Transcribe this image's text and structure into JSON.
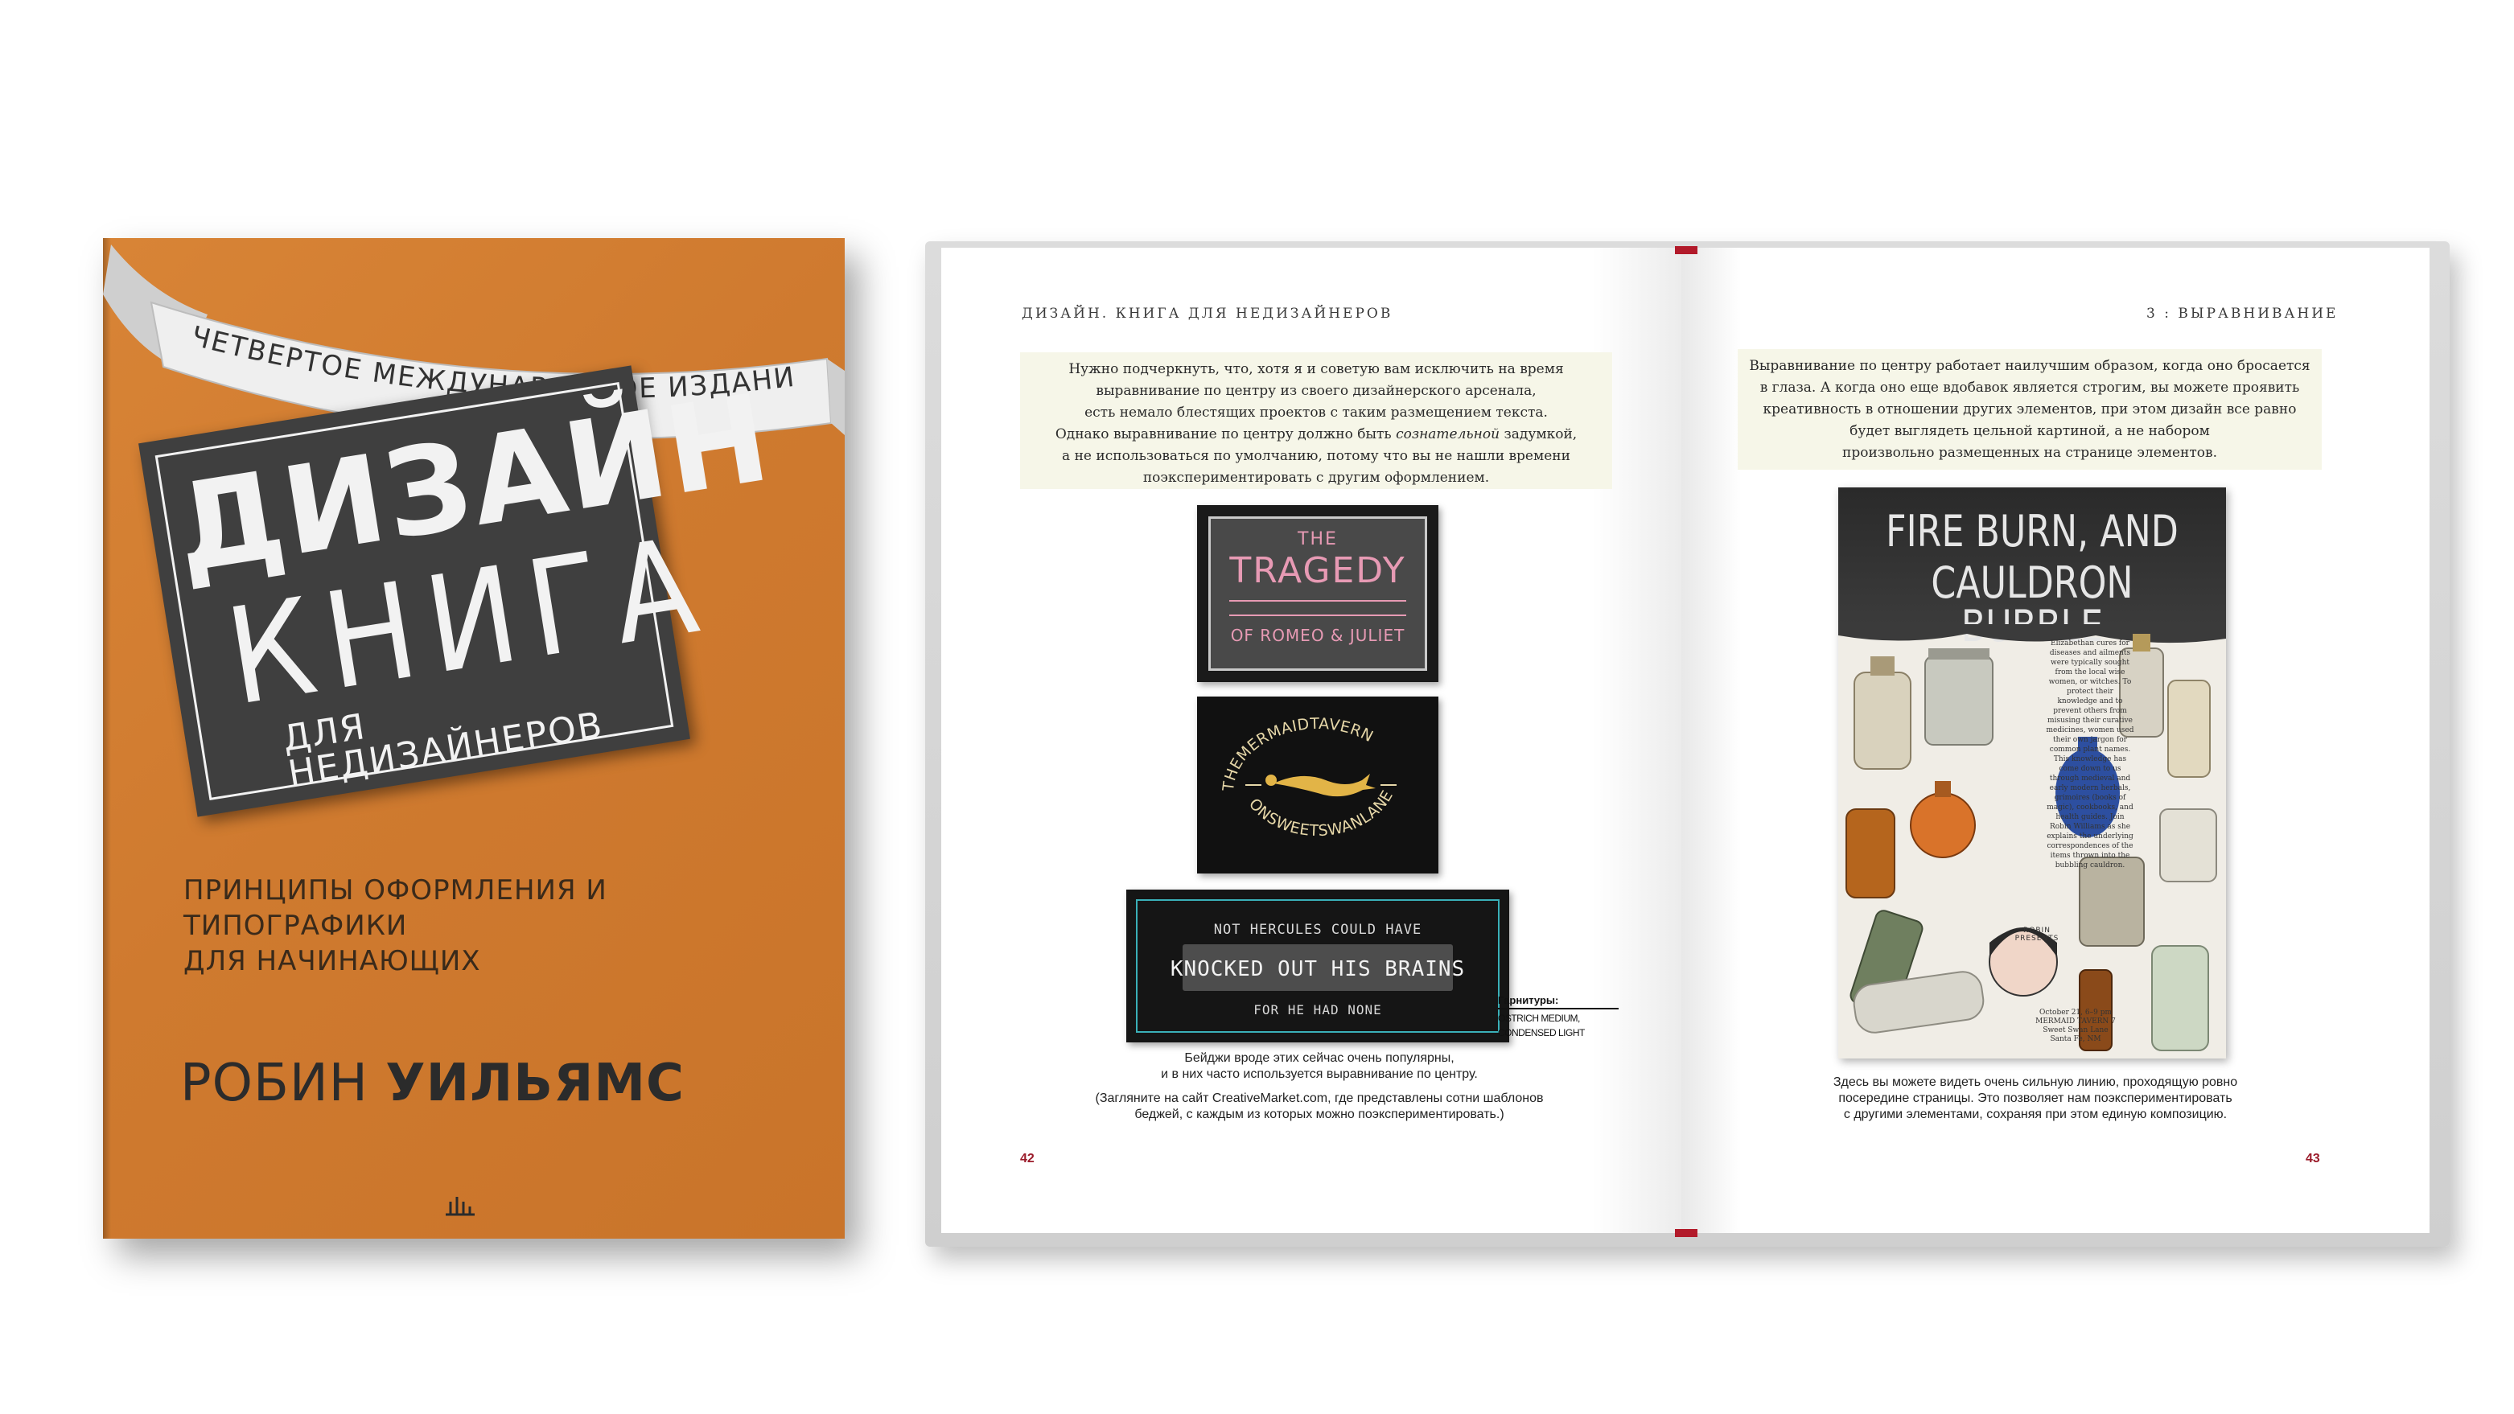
{
  "cover": {
    "edition": "ЧЕТВЕРТОЕ МЕЖДУНАРОДНОЕ ИЗДАНИЕ",
    "title_main": "ДИЗАЙН",
    "title_second": "КНИГА",
    "title_third": "ДЛЯ НЕДИЗАЙНЕРОВ",
    "subtitle_line1": "ПРИНЦИПЫ ОФОРМЛЕНИЯ И ТИПОГРАФИКИ",
    "subtitle_line2": "ДЛЯ НАЧИНАЮЩИХ",
    "author_first": "РОБИН",
    "author_last": "УИЛЬЯМС",
    "colors": {
      "cover": "#d17c30",
      "plate": "#3f3f3f",
      "ribbon": "#efefef"
    }
  },
  "left_page": {
    "running_head": "ДИЗАЙН. КНИГА ДЛЯ НЕДИЗАЙНЕРОВ",
    "note_lines": [
      "Нужно подчеркнуть, что, хотя я и советую вам исключить на время",
      "выравнивание по центру из своего дизайнерского арсенала,",
      "есть немало блестящих проектов с таким размещением текста.",
      "Однако выравнивание по центру должно быть ",
      "сознательной",
      " задумкой,",
      "а не использоваться по умолчанию, потому что вы не нашли времени",
      "поэкспериментировать с другим оформлением."
    ],
    "badge1": {
      "top": "THE",
      "main": "TRAGEDY",
      "sub": "OF ROMEO & JULIET"
    },
    "badge2": {
      "top": "THEMERMAIDTAVERN",
      "bottom": "ONSWEETSWANLANE"
    },
    "badge3": {
      "line1": "NOT HERCULES COULD HAVE",
      "line2": "KNOCKED OUT HIS BRAINS",
      "line3": "FOR HE HAD NONE"
    },
    "fonts_label": "Гарнитуры:",
    "fonts_value1": "OSTRICH MEDIUM,",
    "fonts_value2": "CONDENSED LIGHT",
    "caption1_line1": "Бейджи вроде этих сейчас очень популярны,",
    "caption1_line2": "и в них часто используется выравнивание по центру.",
    "caption2_line1": "(Загляните на сайт CreativeMarket.com, где представлены сотни шаблонов",
    "caption2_line2": "беджей, с каждым из которых можно поэкспериментировать.)",
    "page_number": "42"
  },
  "right_page": {
    "running_head": "3 : ВЫРАВНИВАНИЕ",
    "note_lines": [
      "Выравнивание по центру работает наилучшим образом, когда оно бросается",
      "в глаза. А когда оно еще вдобавок является строгим, вы можете проявить",
      "креативность в отношении других элементов, при этом дизайн все равно",
      "будет выглядеть цельной картиной, а не набором",
      "произвольно размещенных на странице элементов."
    ],
    "poster": {
      "title1": "FIRE BURN, AND",
      "title2": "CAULDRON BUBBLE",
      "body": "Elizabethan cures for diseases and ailments were typically sought from the local wise women, or witches. To protect their knowledge and to prevent others from misusing their curative medicines, women used their own jargon for common plant names. This knowledge has come down to us through medieval and early modern herbals, grimoires (books of magic), cookbooks, and health guides. Join Robin Williams as she explains the underlying correspondences of the items thrown into the bubbling cauldron.",
      "presents": "ROBIN PRESENTS",
      "event": "October 21, 6–9 pm MERMAID TAVERN 7 Sweet Swan Lane Santa Fe, NM"
    },
    "caption_line1": "Здесь вы можете видеть очень сильную линию, проходящую ровно",
    "caption_line2": "посередине страницы. Это позволяет нам поэкспериментировать",
    "caption_line3": "с другими элементами, сохраняя при этом единую композицию.",
    "page_number": "43"
  }
}
